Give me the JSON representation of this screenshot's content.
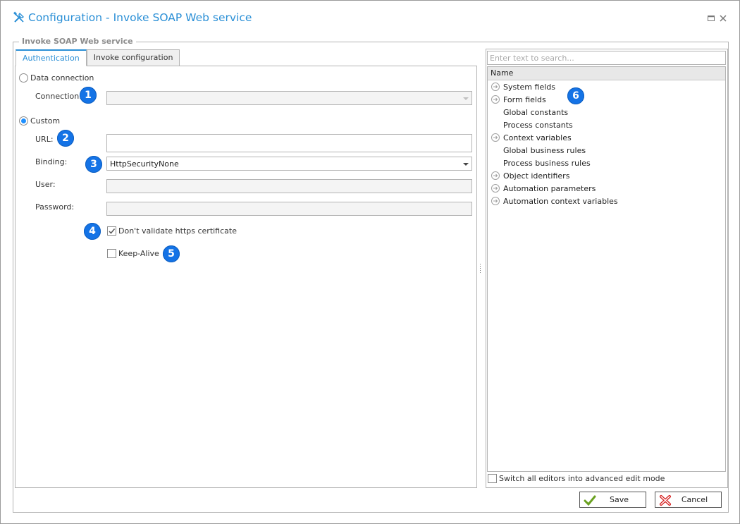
{
  "window": {
    "title": "Configuration - Invoke SOAP Web service",
    "maximize_icon": "maximize-icon",
    "close_icon": "close-icon"
  },
  "group": {
    "legend": "Invoke SOAP Web service"
  },
  "tabs": [
    {
      "label": "Authentication",
      "active": true
    },
    {
      "label": "Invoke configuration",
      "active": false
    }
  ],
  "authentication": {
    "data_connection": {
      "label": "Data connection",
      "selected": false
    },
    "connection": {
      "label": "Connection:",
      "value": "",
      "badge": "1",
      "enabled": false
    },
    "custom": {
      "label": "Custom",
      "selected": true
    },
    "url": {
      "label": "URL:",
      "value": "",
      "badge": "2"
    },
    "binding": {
      "label": "Binding:",
      "value": "HttpSecurityNone",
      "badge": "3"
    },
    "user": {
      "label": "User:",
      "value": "",
      "enabled": false
    },
    "password": {
      "label": "Password:",
      "value": "",
      "enabled": false
    },
    "dont_validate_https": {
      "label": "Don't validate https certificate",
      "checked": true,
      "badge": "4"
    },
    "keep_alive": {
      "label": "Keep-Alive",
      "checked": false,
      "badge": "5"
    }
  },
  "variables_panel": {
    "search_placeholder": "Enter text to search...",
    "column_header": "Name",
    "badge": "6",
    "items": [
      {
        "label": "System fields",
        "expandable": true
      },
      {
        "label": "Form fields",
        "expandable": true
      },
      {
        "label": "Global constants",
        "expandable": false
      },
      {
        "label": "Process constants",
        "expandable": false
      },
      {
        "label": "Context variables",
        "expandable": true
      },
      {
        "label": "Global business rules",
        "expandable": false
      },
      {
        "label": "Process business rules",
        "expandable": false
      },
      {
        "label": "Object identifiers",
        "expandable": true
      },
      {
        "label": "Automation parameters",
        "expandable": true
      },
      {
        "label": "Automation context variables",
        "expandable": true
      }
    ],
    "advanced_mode": {
      "label": "Switch all editors into advanced edit mode",
      "checked": false
    }
  },
  "footer": {
    "save_label": "Save",
    "cancel_label": "Cancel"
  },
  "colors": {
    "accent": "#2a8fd6",
    "badge": "#1473e6",
    "save_icon": "#6aa121",
    "cancel_icon": "#d62020"
  }
}
